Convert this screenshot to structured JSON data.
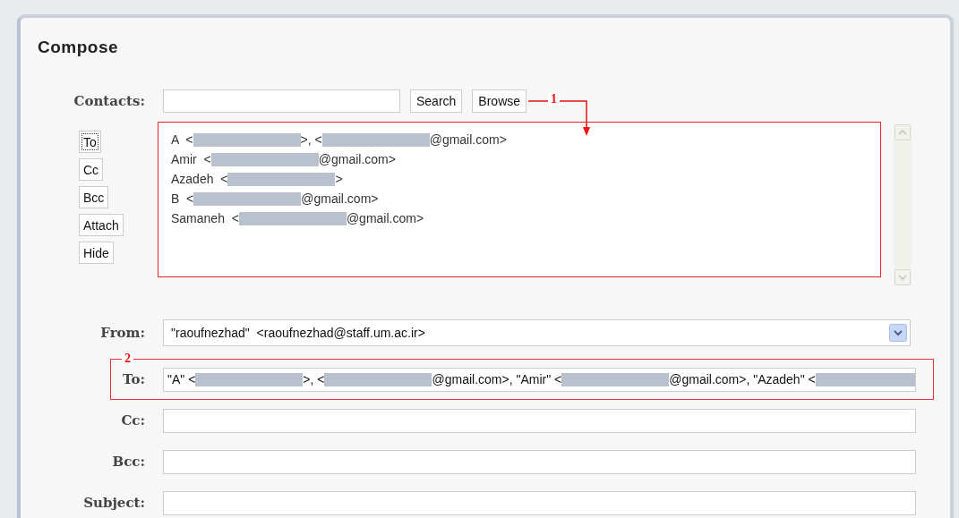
{
  "title": "Compose",
  "contacts": {
    "label": "Contacts:",
    "buttons": [
      "Search",
      "Browse"
    ]
  },
  "side_buttons": [
    {
      "label": "To",
      "focused": true
    },
    {
      "label": "Cc",
      "focused": false
    },
    {
      "label": "Bcc",
      "focused": false
    },
    {
      "label": "Attach",
      "focused": false
    },
    {
      "label": "Hide",
      "focused": false
    }
  ],
  "contact_list": [
    {
      "parts": [
        {
          "kind": "text",
          "text": "A  <"
        },
        {
          "kind": "redacted"
        },
        {
          "kind": "text",
          "text": ">, <"
        },
        {
          "kind": "redacted"
        },
        {
          "kind": "text",
          "text": "@gmail.com>"
        }
      ]
    },
    {
      "parts": [
        {
          "kind": "text",
          "text": "Amir  <"
        },
        {
          "kind": "redacted"
        },
        {
          "kind": "text",
          "text": "@gmail.com>"
        }
      ]
    },
    {
      "parts": [
        {
          "kind": "text",
          "text": "Azadeh  <"
        },
        {
          "kind": "redacted"
        },
        {
          "kind": "text",
          "text": ">"
        }
      ]
    },
    {
      "parts": [
        {
          "kind": "text",
          "text": "B  <"
        },
        {
          "kind": "redacted"
        },
        {
          "kind": "text",
          "text": "@gmail.com>"
        }
      ]
    },
    {
      "parts": [
        {
          "kind": "text",
          "text": "Samaneh  <"
        },
        {
          "kind": "redacted"
        },
        {
          "kind": "text",
          "text": "@gmail.com>"
        }
      ]
    }
  ],
  "from": {
    "label": "From:",
    "value": "\"raoufnezhad\"  <raoufnezhad@staff.um.ac.ir>"
  },
  "to": {
    "label": "To:",
    "parts": [
      {
        "kind": "text",
        "text": "\"A\" <"
      },
      {
        "kind": "redacted"
      },
      {
        "kind": "text",
        "text": ">, <"
      },
      {
        "kind": "redacted"
      },
      {
        "kind": "text",
        "text": "@gmail.com>, \"Amir\" <"
      },
      {
        "kind": "redacted"
      },
      {
        "kind": "text",
        "text": "@gmail.com>, \"Azadeh\" <"
      },
      {
        "kind": "redacted"
      }
    ]
  },
  "cc": {
    "label": "Cc:"
  },
  "bcc": {
    "label": "Bcc:"
  },
  "subject": {
    "label": "Subject:"
  },
  "annotations": [
    {
      "label": "1"
    },
    {
      "label": "2"
    }
  ]
}
